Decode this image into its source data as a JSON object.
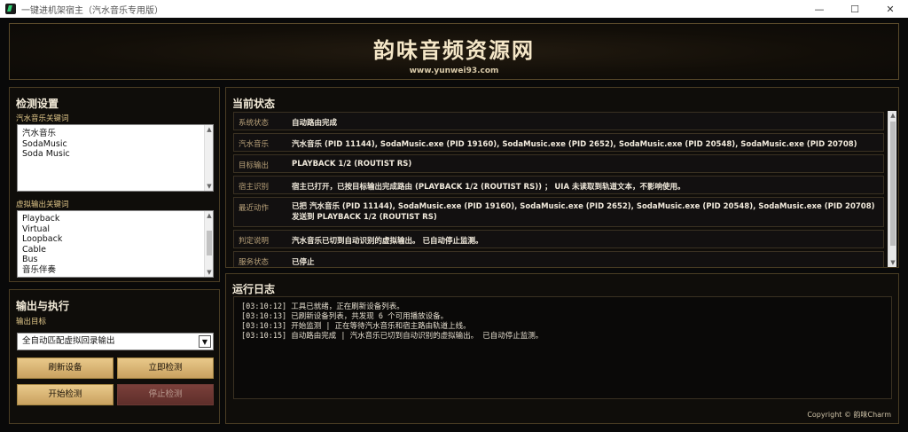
{
  "window": {
    "title": "一键进机架宿主（汽水音乐专用版）",
    "minimize": "—",
    "maximize": "☐",
    "close": "✕"
  },
  "header": {
    "title": "韵味音频资源网",
    "url": "www.yunwei93.com"
  },
  "detect": {
    "title": "检测设置",
    "music_label": "汽水音乐关键词",
    "music_keywords": [
      "汽水音乐",
      "SodaMusic",
      "Soda Music"
    ],
    "vout_label": "虚拟输出关键词",
    "vout_keywords": [
      "Playback",
      "Virtual",
      "Loopback",
      "Cable",
      "Bus",
      "音乐伴奏"
    ]
  },
  "output": {
    "title": "输出与执行",
    "target_label": "输出目标",
    "target_value": "全自动匹配虚拟回录输出",
    "buttons": {
      "refresh": "刷新设备",
      "detect_now": "立即检测",
      "start": "开始检测",
      "stop": "停止检测"
    }
  },
  "status": {
    "title": "当前状态",
    "rows": [
      {
        "key": "系统状态",
        "value": "自动路由完成"
      },
      {
        "key": "汽水音乐",
        "value": "汽水音乐 (PID 11144), SodaMusic.exe (PID 19160), SodaMusic.exe (PID 2652), SodaMusic.exe (PID 20548), SodaMusic.exe (PID 20708)"
      },
      {
        "key": "目标输出",
        "value": "PLAYBACK 1/2 (ROUTIST RS)"
      },
      {
        "key": "宿主识别",
        "value": "宿主已打开，已按目标输出完成路由 (PLAYBACK 1/2 (ROUTIST RS)) ； UIA 未读取到轨道文本，不影响使用。"
      },
      {
        "key": "最近动作",
        "value": "已把 汽水音乐 (PID 11144), SodaMusic.exe (PID 19160), SodaMusic.exe (PID 2652), SodaMusic.exe (PID 20548), SodaMusic.exe (PID 20708) 发送到 PLAYBACK 1/2 (ROUTIST RS)"
      },
      {
        "key": "判定说明",
        "value": "汽水音乐已切到自动识别的虚拟输出。 已自动停止监测。"
      },
      {
        "key": "服务状态",
        "value": "已停止"
      }
    ]
  },
  "log": {
    "title": "运行日志",
    "lines": [
      "[03:10:12] 工具已就绪，正在刷新设备列表。",
      "[03:10:13] 已刷新设备列表，共发现 6 个可用播放设备。",
      "[03:10:13] 开始监测 | 正在等待汽水音乐和宿主路由轨道上线。",
      "[03:10:15] 自动路由完成 | 汽水音乐已切到自动识别的虚拟输出。 已自动停止监测。"
    ]
  },
  "footer": {
    "copyright": "Copyright © 韵味Charm"
  }
}
